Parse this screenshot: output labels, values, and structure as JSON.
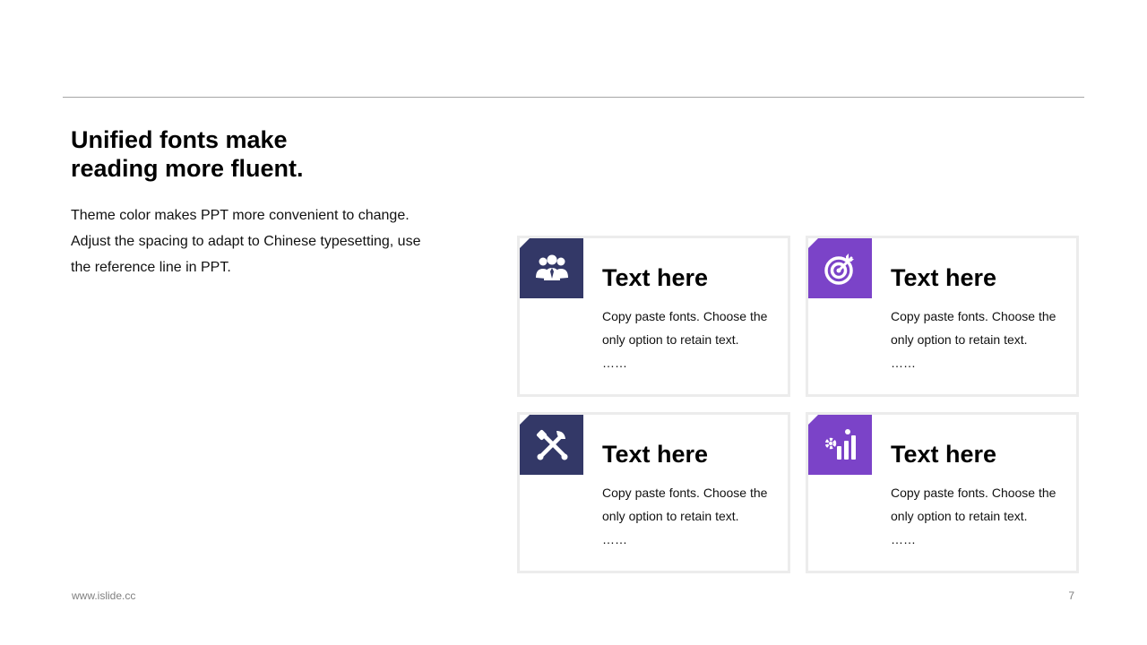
{
  "slide": {
    "headline_line1": "Unified fonts make",
    "headline_line2": "reading more fluent.",
    "intro_line1": "Theme color makes PPT more convenient to change.",
    "intro_line2": "Adjust the spacing to adapt to Chinese typesetting, use",
    "intro_line3": "the reference line in PPT.",
    "colors": {
      "navy": "#333867",
      "purple": "#7b43c8",
      "rule": "#a6a6a6",
      "card_border": "#ececec"
    }
  },
  "cards": [
    {
      "icon": "team-icon",
      "title": "Text here",
      "body_line1": "Copy paste fonts. Choose the",
      "body_line2": "only option to retain text.",
      "ellipsis": "……"
    },
    {
      "icon": "target-icon",
      "title": "Text here",
      "body_line1": "Copy paste fonts. Choose the",
      "body_line2": "only option to retain text.",
      "ellipsis": "……"
    },
    {
      "icon": "tools-icon",
      "title": "Text here",
      "body_line1": "Copy paste fonts. Choose the",
      "body_line2": "only option to retain text.",
      "ellipsis": "……"
    },
    {
      "icon": "chart-gear-icon",
      "title": "Text here",
      "body_line1": "Copy paste fonts. Choose the",
      "body_line2": "only option to retain text.",
      "ellipsis": "……"
    }
  ],
  "footer": {
    "url": "www.islide.cc",
    "page": "7"
  }
}
